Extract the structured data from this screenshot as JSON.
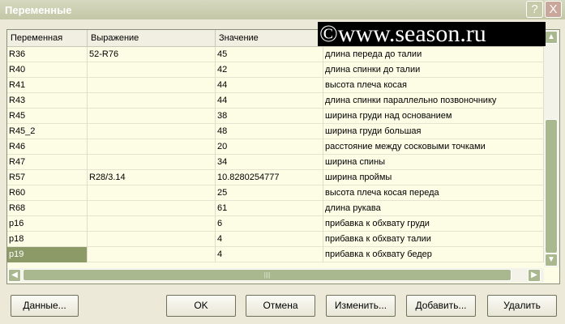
{
  "title": "Переменные",
  "watermark": "©www.season.ru",
  "columns": [
    "Переменная",
    "Выражение",
    "Значение",
    ""
  ],
  "rows": [
    [
      "R36",
      "52-R76",
      "45",
      "длина переда до талии"
    ],
    [
      "R40",
      "",
      "42",
      "длина спинки до талии"
    ],
    [
      "R41",
      "",
      "44",
      "высота плеча косая"
    ],
    [
      "R43",
      "",
      "44",
      "длина спинки параллельно позвоночнику"
    ],
    [
      "R45",
      "",
      "38",
      "ширина груди над основанием"
    ],
    [
      "R45_2",
      "",
      "48",
      "ширина груди большая"
    ],
    [
      "R46",
      "",
      "20",
      "расстояние между сосковыми точками"
    ],
    [
      "R47",
      "",
      "34",
      "ширина спины"
    ],
    [
      "R57",
      "R28/3.14",
      "10.8280254777",
      "ширина проймы"
    ],
    [
      "R60",
      "",
      "25",
      "высота плеча косая переда"
    ],
    [
      "R68",
      "",
      "61",
      "длина рукава"
    ],
    [
      "p16",
      "",
      "6",
      "прибавка к обхвату груди"
    ],
    [
      "p18",
      "",
      "4",
      "прибавка к обхвату талии"
    ],
    [
      "p19",
      "",
      "4",
      "прибавка к обхвату бедер"
    ]
  ],
  "selected_row": 13,
  "buttons": {
    "data": "Данные...",
    "ok": "OK",
    "cancel": "Отмена",
    "edit": "Изменить...",
    "add": "Добавить...",
    "delete": "Удалить"
  },
  "help": "?",
  "close": "X"
}
